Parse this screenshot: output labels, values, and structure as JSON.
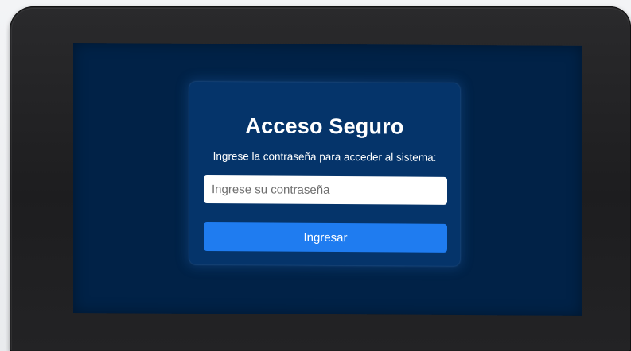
{
  "login": {
    "title": "Acceso Seguro",
    "instruction": "Ingrese la contraseña para acceder al sistema:",
    "password_placeholder": "Ingrese su contraseña",
    "password_value": "",
    "submit_label": "Ingresar"
  },
  "colors": {
    "screen_background": "#012247",
    "card_background": "#05346a",
    "button": "#1f7cf0",
    "text": "#ffffff"
  }
}
